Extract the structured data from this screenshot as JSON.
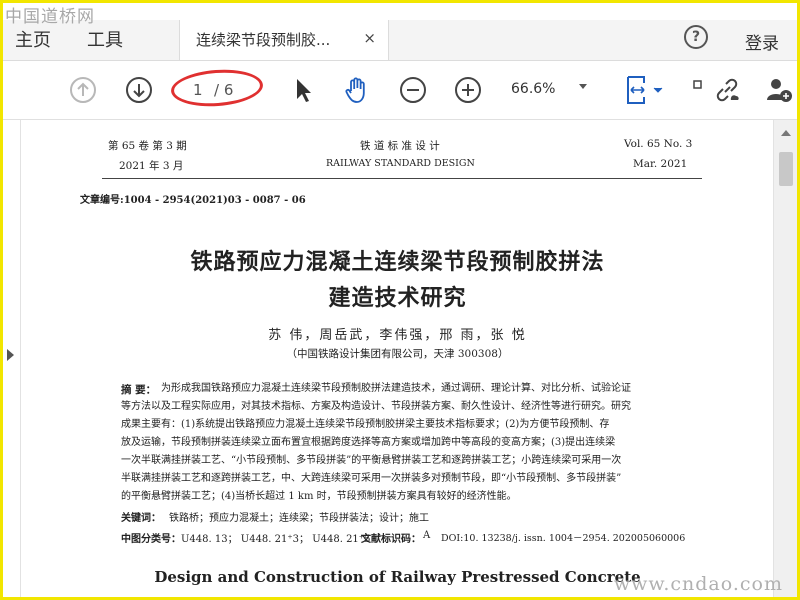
{
  "watermark": {
    "top": "中国道桥网",
    "bottom": "www.cndao.com"
  },
  "menu": {
    "home": "主页",
    "tools": "工具",
    "login": "登录"
  },
  "tab": {
    "title": "连续梁节段预制胶...",
    "close": "×"
  },
  "toolbar": {
    "page_current": "1",
    "page_total": "/ 6",
    "zoom": "66.6%",
    "icons": [
      "arrow-up-icon",
      "arrow-down-icon",
      "select-pointer-icon",
      "hand-icon",
      "zoom-out-icon",
      "zoom-in-icon",
      "fit-width-icon",
      "link-icon",
      "add-user-icon"
    ]
  },
  "colors": {
    "watermark_border": "#f2e600",
    "annotation": "#e03030"
  },
  "document": {
    "header_left_1": "第 65 卷   第 3 期",
    "header_left_2": "2021 年 3 月",
    "header_center_1": "铁 道 标 准 设 计",
    "header_center_2": "RAILWAY    STANDARD    DESIGN",
    "header_right_1": "Vol. 65    No. 3",
    "header_right_2": "Mar.   2021",
    "article_no": "文章编号:1004 - 2954(2021)03 - 0087 - 06",
    "title_1": "铁路预应力混凝土连续梁节段预制胶拼法",
    "title_2": "建造技术研究",
    "authors": "苏  伟，周岳武，李伟强，邢  雨，张  悦",
    "affiliation": "（中国铁路设计集团有限公司，天津   300308）",
    "abstract_label": "摘  要：",
    "abstract_lines": [
      "为形成我国铁路预应力混凝土连续梁节段预制胶拼法建造技术，通过调研、理论计算、对比分析、试验论证",
      "等方法以及工程实际应用，对其技术指标、方案及构造设计、节段拼装方案、耐久性设计、经济性等进行研究。研究",
      "成果主要有：(1)系统提出铁路预应力混凝土连续梁节段预制胶拼梁主要技术指标要求；(2)为方便节段预制、存",
      "放及运输，节段预制拼装连续梁立面布置宜根据跨度选择等高方案或增加跨中等高段的变高方案；(3)提出连续梁",
      "一次半联满挂拼装工艺、“小节段预制、多节段拼装”的平衡悬臂拼装工艺和逐跨拼装工艺；小跨连续梁可采用一次",
      "半联满挂拼装工艺和逐跨拼装工艺，中、大跨连续梁可采用一次拼装多对预制节段，即“小节段预制、多节段拼装”",
      "的平衡悬臂拼装工艺；(4)当桥长超过 1 km 时，节段预制拼装方案具有较好的经济性能。"
    ],
    "keywords_label": "关键词：",
    "keywords": "铁路桥；预应力混凝土；连续梁；节段拼装法；设计；施工",
    "clc_label": "中图分类号：",
    "clc": "U448. 13；  U448. 21⁺3；  U448. 21⁺5",
    "doc_code_label": "文献标识码：",
    "doc_code": "A",
    "doi": "DOI:10. 13238/j. issn. 1004－2954. 202005060006",
    "en_title": "Design and Construction of Railway Prestressed Concrete"
  }
}
